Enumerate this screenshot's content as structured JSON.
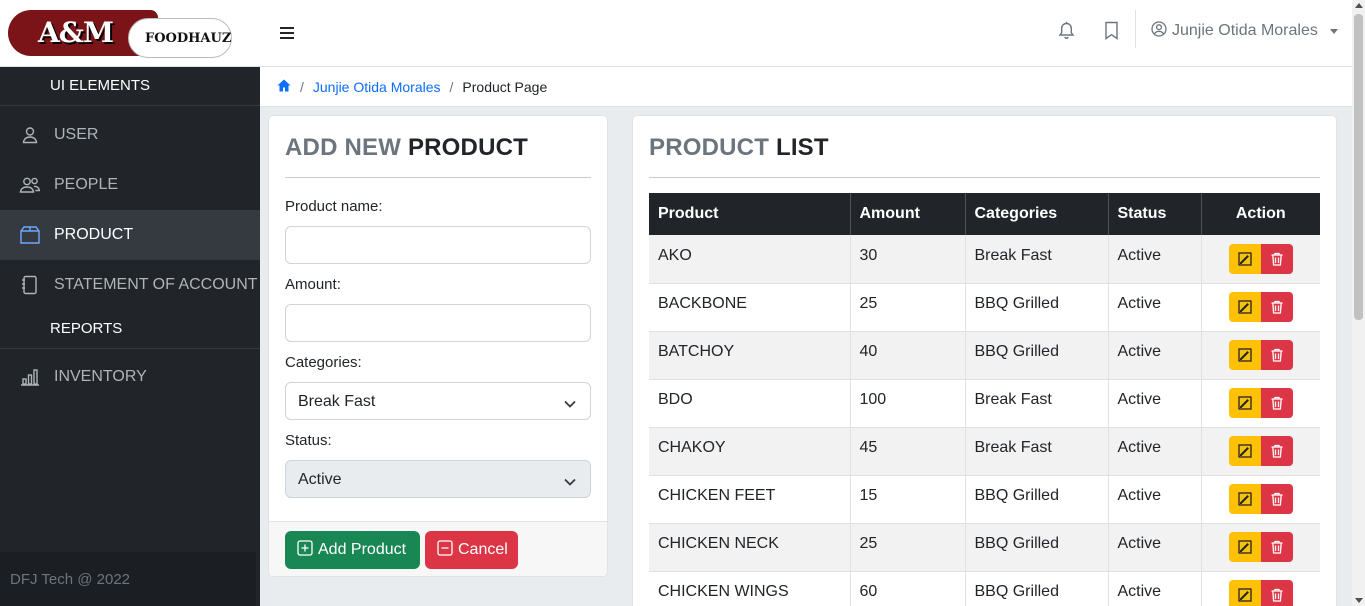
{
  "brand": {
    "logo_main": "A&M",
    "logo_sub": "FOODHAUZ"
  },
  "header": {
    "user_name": "Junjie Otida Morales",
    "icons": [
      "menu-icon",
      "bell-icon",
      "bookmark-icon",
      "user-circle-icon"
    ]
  },
  "sidebar": {
    "items": [
      {
        "label": "UI ELEMENTS",
        "icon": ""
      },
      {
        "label": "USER",
        "icon": "user-icon"
      },
      {
        "label": "PEOPLE",
        "icon": "people-icon"
      },
      {
        "label": "PRODUCT",
        "icon": "box-icon",
        "active": true
      },
      {
        "label": "STATEMENT OF ACCOUNT",
        "icon": "journal-icon"
      },
      {
        "label": "REPORTS",
        "icon": ""
      },
      {
        "label": "INVENTORY",
        "icon": "bar-chart-icon"
      }
    ],
    "footer": "DFJ Tech @ 2022"
  },
  "breadcrumb": {
    "home_icon": "home-icon",
    "user": "Junjie Otida Morales",
    "current": "Product Page"
  },
  "form": {
    "title_light": "ADD NEW",
    "title_bold": "PRODUCT",
    "product_name_label": "Product name:",
    "product_name_value": "",
    "amount_label": "Amount:",
    "amount_value": "",
    "categories_label": "Categories:",
    "categories_value": "Break Fast",
    "status_label": "Status:",
    "status_value": "Active",
    "add_button": "Add Product",
    "cancel_button": "Cancel"
  },
  "list": {
    "title_light": "PRODUCT",
    "title_bold": "LIST",
    "columns": [
      "Product",
      "Amount",
      "Categories",
      "Status",
      "Action"
    ],
    "rows": [
      {
        "product": "AKO",
        "amount": "30",
        "category": "Break Fast",
        "status": "Active"
      },
      {
        "product": "BACKBONE",
        "amount": "25",
        "category": "BBQ Grilled",
        "status": "Active"
      },
      {
        "product": "BATCHOY",
        "amount": "40",
        "category": "BBQ Grilled",
        "status": "Active"
      },
      {
        "product": "BDO",
        "amount": "100",
        "category": "Break Fast",
        "status": "Active"
      },
      {
        "product": "CHAKOY",
        "amount": "45",
        "category": "Break Fast",
        "status": "Active"
      },
      {
        "product": "CHICKEN FEET",
        "amount": "15",
        "category": "BBQ Grilled",
        "status": "Active"
      },
      {
        "product": "CHICKEN NECK",
        "amount": "25",
        "category": "BBQ Grilled",
        "status": "Active"
      },
      {
        "product": "CHICKEN WINGS",
        "amount": "60",
        "category": "BBQ Grilled",
        "status": "Active"
      }
    ]
  },
  "colors": {
    "sidebar_bg": "#212529",
    "table_head": "#212529",
    "edit": "#ffc107",
    "delete": "#dc3545",
    "add": "#198754",
    "link": "#0d6efd",
    "logo_red": "#7a1418"
  }
}
